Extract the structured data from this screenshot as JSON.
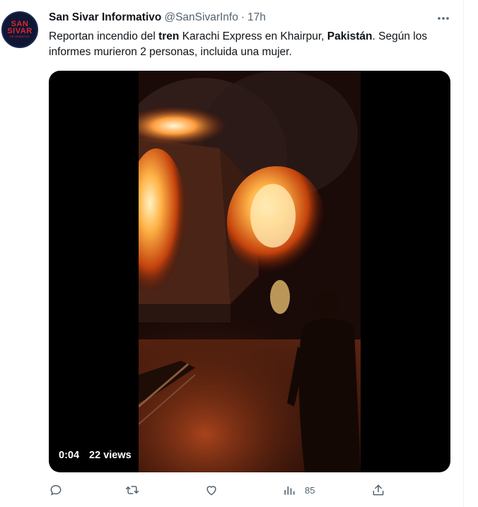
{
  "tweet": {
    "avatar": {
      "line1": "SAN",
      "line2": "SIVAR",
      "line3": "INFORMATIVO"
    },
    "author_name": "San Sivar Informativo",
    "handle": "@SanSivarInfo",
    "separator": "·",
    "time": "17h",
    "text": {
      "p1": "Reportan incendio del ",
      "b1": "tren",
      "p2": " Karachi Express en Khairpur, ",
      "b2": "Pakistán",
      "p3": ". Según los informes murieron 2 personas, incluida una mujer."
    },
    "video": {
      "time": "0:04",
      "views": "22 views"
    },
    "actions": {
      "reply_icon": "reply-icon",
      "retweet_icon": "retweet-icon",
      "like_icon": "heart-icon",
      "views_icon": "bar-chart-icon",
      "views_count": "85",
      "share_icon": "share-icon"
    }
  }
}
